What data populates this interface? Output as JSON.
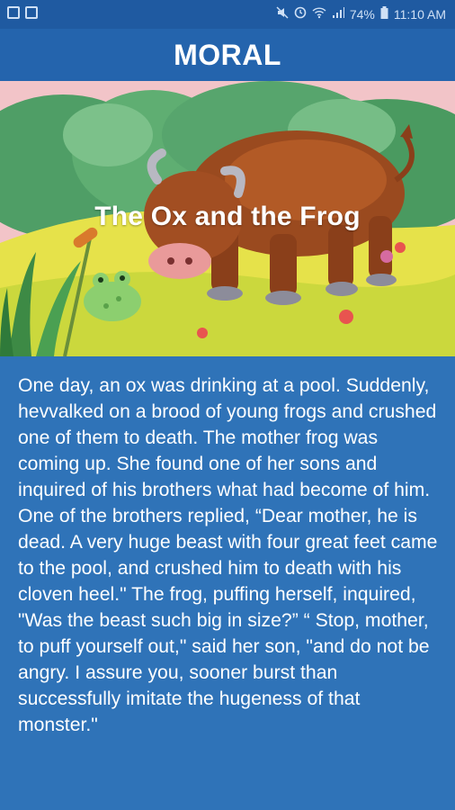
{
  "status_bar": {
    "battery_percent": "74%",
    "time": "11:10 AM",
    "icons": [
      "gallery-icon",
      "photo-icon",
      "mute-icon",
      "alarm-icon",
      "wifi-icon",
      "signal-icon",
      "battery-icon"
    ]
  },
  "app_bar": {
    "title": "MORAL"
  },
  "hero": {
    "title": "The Ox and the Frog",
    "illustration": "ox-and-frog-illustration"
  },
  "story": {
    "text": "One day, an ox was drinking at a pool. Suddenly, hevvalked on a brood of young frogs and crushed one of them to death. The mother frog was coming up. She found one of her sons and inquired of his brothers what had become of him. One of the brothers replied, “Dear mother, he is dead. A very huge beast with four great feet came to the pool, and crushed him to death with his cloven heel.\" The frog, puffing herself, inquired, \"Was the beast such big in size?” “ Stop, mother, to puff yourself out,\" said her son, \"and do not be angry. I assure you, sooner burst than successfully imitate the hugeness of that monster.\""
  },
  "colors": {
    "status_bar": "#1f5aa1",
    "app_bar": "#2464ad",
    "background": "#2f73b8",
    "text": "#ffffff"
  }
}
